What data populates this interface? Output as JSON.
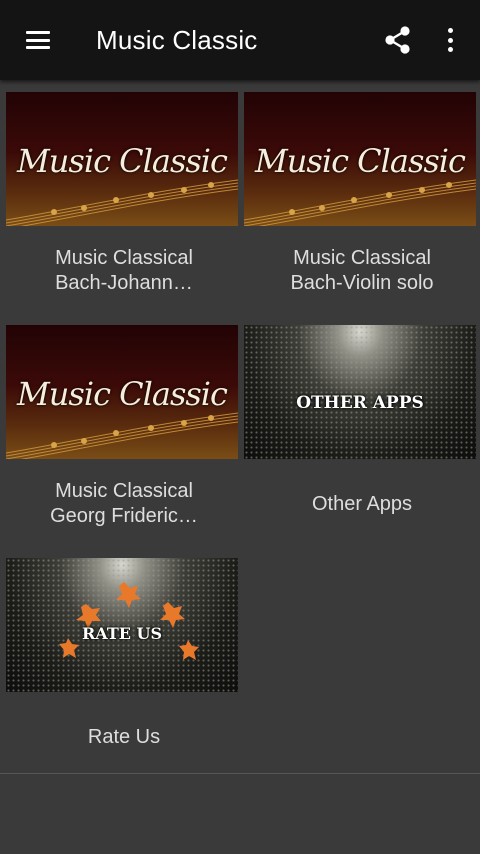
{
  "appbar": {
    "title": "Music Classic",
    "icons": {
      "menu": "hamburger-menu-icon",
      "share": "share-icon",
      "more": "more-vert-icon"
    }
  },
  "grid": {
    "items": [
      {
        "thumb_text": "Music Classic",
        "caption": [
          "Music Classical",
          "Bach-Johann…"
        ]
      },
      {
        "thumb_text": "Music Classic",
        "caption": [
          "Music Classical",
          "Bach-Violin solo"
        ]
      },
      {
        "thumb_text": "Music Classic",
        "caption": [
          "Music Classical",
          "Georg Frideric…"
        ]
      },
      {
        "thumb_text": "OTHER APPS",
        "caption": [
          "Other Apps"
        ]
      },
      {
        "thumb_text": "RATE US",
        "caption": [
          "Rate Us"
        ]
      }
    ]
  },
  "colors": {
    "appbar": "#141414",
    "background": "#3a3a3a",
    "star": "#e8792b"
  }
}
